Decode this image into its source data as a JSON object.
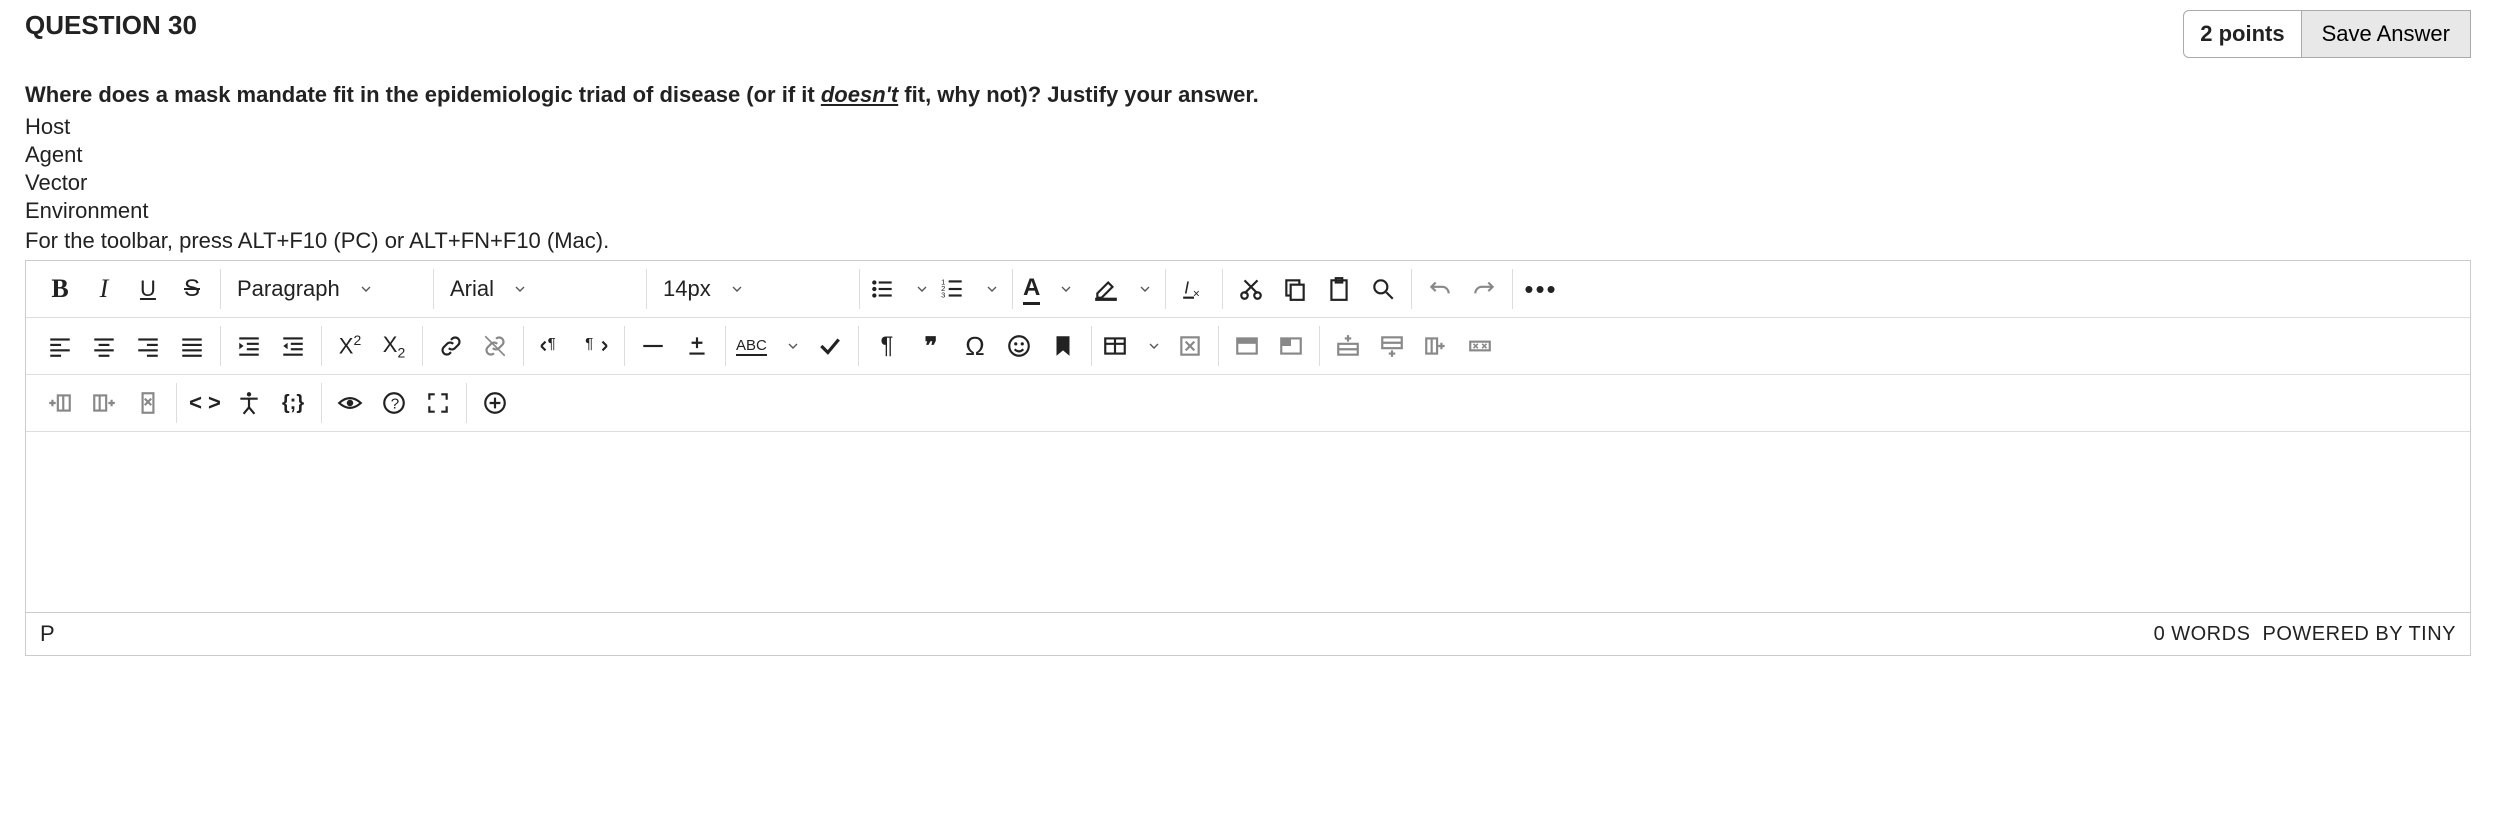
{
  "header": {
    "question_label": "QUESTION 30",
    "points": "2 points",
    "save": "Save Answer"
  },
  "prompt": {
    "main_a": "Where does a mask mandate fit in the epidemiologic triad of disease (or if it ",
    "doesnt": "doesn't",
    "main_b": " fit, why not)? Justify your answer."
  },
  "options": [
    "Host",
    "Agent",
    "Vector",
    "Environment"
  ],
  "hint": "For the toolbar, press ALT+F10 (PC) or ALT+FN+F10 (Mac).",
  "toolbar": {
    "bold": "B",
    "italic": "I",
    "underline": "U",
    "strike": "S",
    "block_format": "Paragraph",
    "font_family": "Arial",
    "font_size": "14px",
    "text_color": "A",
    "superscript_base": "X",
    "subscript_base": "X",
    "abc": "ABC",
    "quote": "❝❞",
    "omega": "Ω",
    "pilcrow": "¶",
    "code": "< >",
    "braces": "{;}",
    "more": "•••"
  },
  "status": {
    "path": "P",
    "words": "0 WORDS",
    "credit": "POWERED BY TINY"
  }
}
